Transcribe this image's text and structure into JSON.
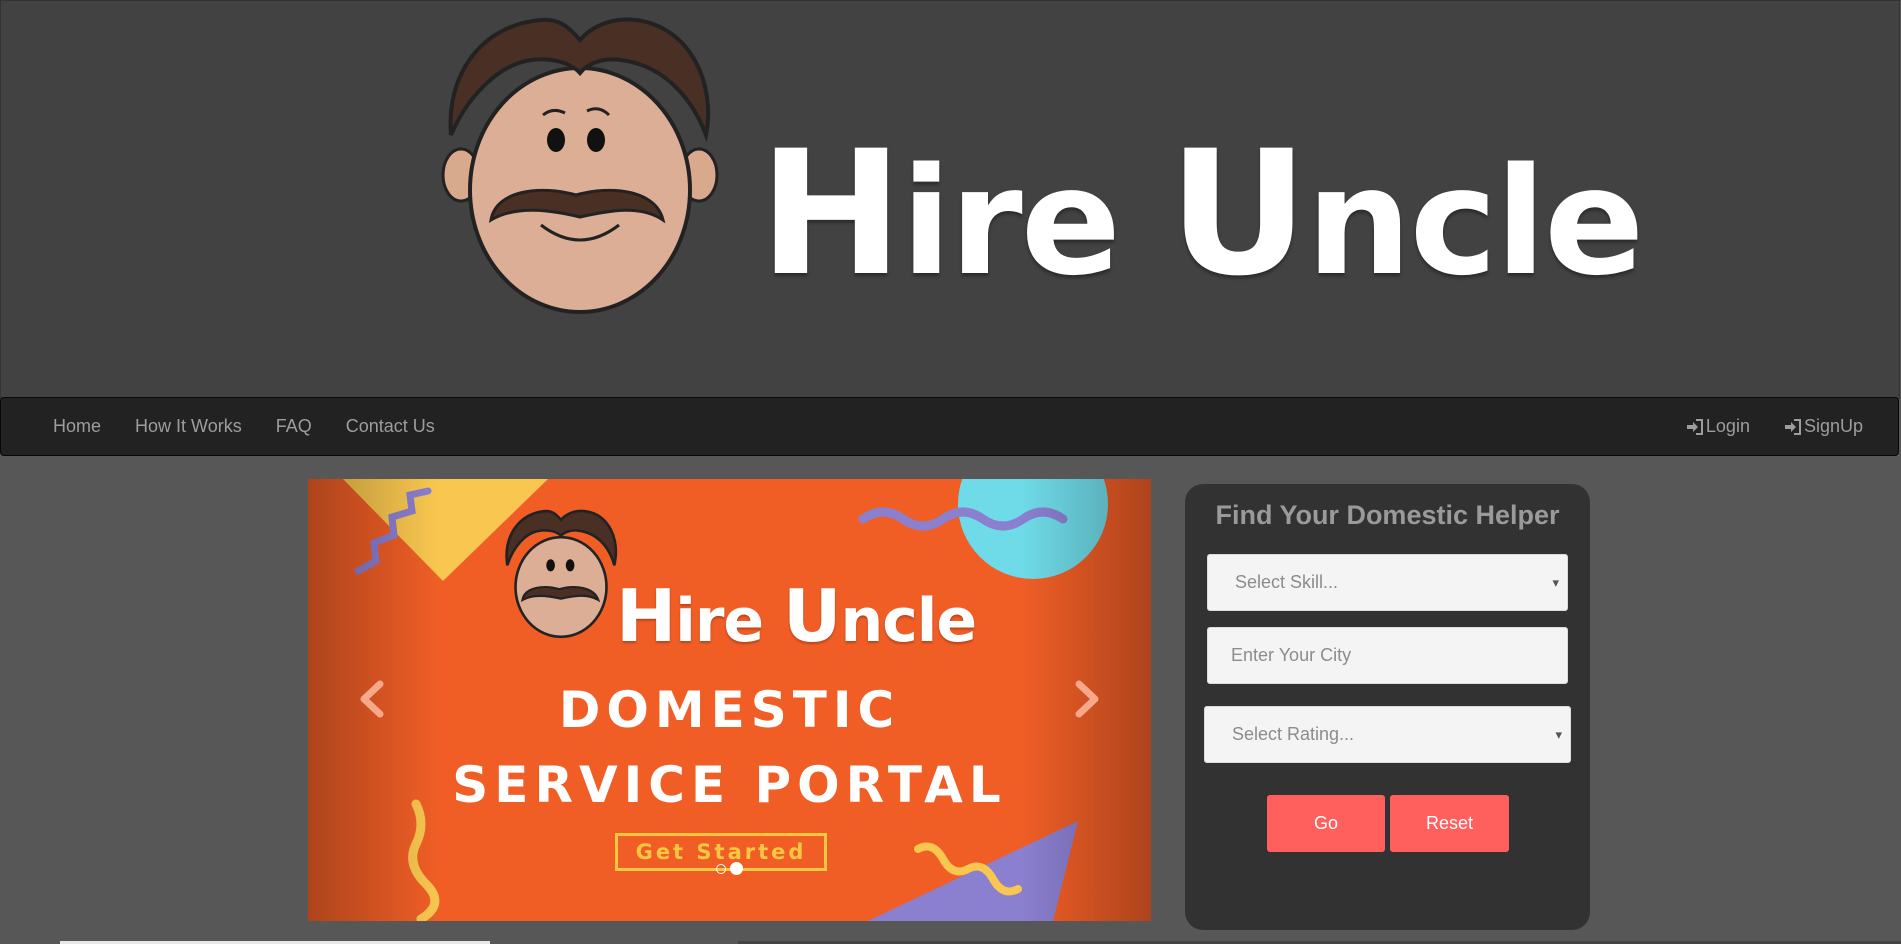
{
  "brand": {
    "name_part1_initial": "H",
    "name_part1_rest": "ire ",
    "name_part2_initial": "U",
    "name_part2_rest": "ncle",
    "logo_icon": "mustache-uncle-face-icon"
  },
  "nav": {
    "left": [
      {
        "label": "Home"
      },
      {
        "label": "How It Works"
      },
      {
        "label": "FAQ"
      },
      {
        "label": "Contact Us"
      }
    ],
    "right": [
      {
        "label": "Login",
        "icon": "login-icon"
      },
      {
        "label": "SignUp",
        "icon": "login-icon"
      }
    ]
  },
  "carousel": {
    "brand_initial1": "H",
    "brand_rest1": "ire ",
    "brand_initial2": "U",
    "brand_rest2": "ncle",
    "line1": "DOMESTIC",
    "line2": "SERVICE PORTAL",
    "cta": "Get Started",
    "slide_count": 2,
    "active_slide": 2,
    "colors": {
      "background": "#f05e26",
      "accent": "#f7c744",
      "purple": "#8b7fd0",
      "cyan": "#6fdbe8"
    }
  },
  "search": {
    "title": "Find Your Domestic Helper",
    "skill_placeholder": "Select Skill...",
    "city_placeholder": "Enter Your City",
    "rating_placeholder": "Select Rating...",
    "go_label": "Go",
    "reset_label": "Reset",
    "button_color": "#ff605e"
  }
}
